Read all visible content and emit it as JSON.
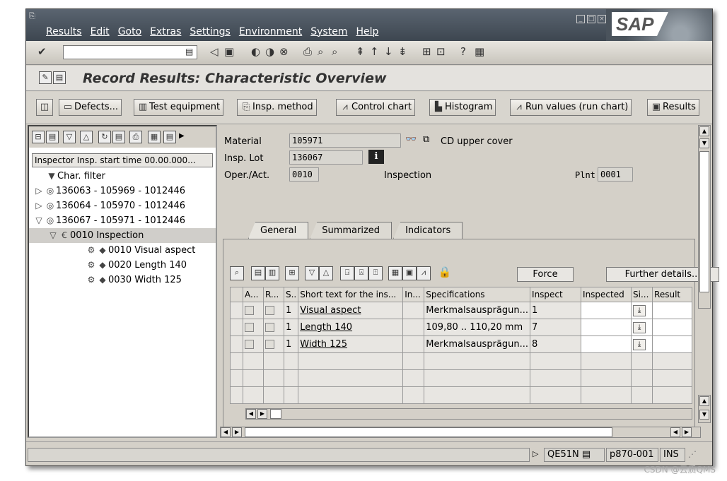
{
  "menu": [
    "Results",
    "Edit",
    "Goto",
    "Extras",
    "Settings",
    "Environment",
    "System",
    "Help"
  ],
  "title": "Record Results: Characteristic Overview",
  "app_buttons": [
    "Defects...",
    "Test equipment",
    "Insp. method",
    "Control chart",
    "Histogram",
    "Run values (run chart)",
    "Results"
  ],
  "left": {
    "header": "Inspector Insp. start time 00.00.000...",
    "tree": [
      {
        "label": "Char. filter"
      },
      {
        "label": "136063 - 105969 - 1012446"
      },
      {
        "label": "136064 - 105970 - 1012446"
      },
      {
        "label": "136067 - 105971 - 1012446"
      },
      {
        "label": "0010 Inspection"
      },
      {
        "label": "0010 Visual aspect"
      },
      {
        "label": "0020 Length 140"
      },
      {
        "label": "0030 Width 125"
      }
    ]
  },
  "header": {
    "material_label": "Material",
    "material_value": "105971",
    "material_desc": "CD upper cover",
    "lot_label": "Insp. Lot",
    "lot_value": "136067",
    "oper_label": "Oper./Act.",
    "oper_value": "0010",
    "oper_desc": "Inspection",
    "plant_label": "Plnt",
    "plant_value": "0001"
  },
  "tabs": [
    "General",
    "Summarized",
    "Indicators"
  ],
  "grid": {
    "force_label": "Force",
    "further_label": "Further details...",
    "columns": [
      "A...",
      "R...",
      "S..",
      "Short text for the ins...",
      "In...",
      "Specifications",
      "Inspect",
      "Inspected",
      "Si...",
      "Result"
    ],
    "rows": [
      {
        "s": "1",
        "text": "Visual aspect",
        "spec": "Merkmalsausprägun...",
        "inspect": "1"
      },
      {
        "s": "1",
        "text": "Length 140",
        "spec": "109,80 .. 110,20 mm",
        "inspect": "7"
      },
      {
        "s": "1",
        "text": "Width 125",
        "spec": "Merkmalsausprägun...",
        "inspect": "8"
      }
    ]
  },
  "status": {
    "tcode": "QE51N",
    "server": "p870-001",
    "mode": "INS"
  },
  "watermark": "CSDN @云质QMS"
}
